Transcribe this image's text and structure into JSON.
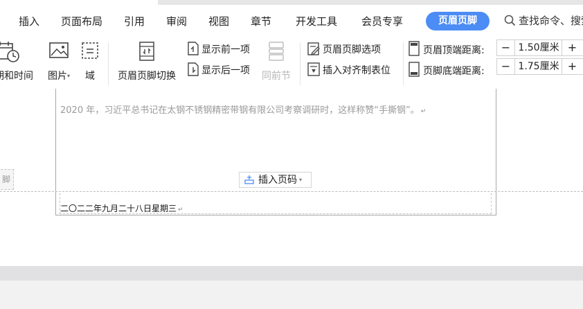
{
  "menubar": {
    "tabs": [
      {
        "label": "插入"
      },
      {
        "label": "页面布局"
      },
      {
        "label": "引用"
      },
      {
        "label": "审阅"
      },
      {
        "label": "视图"
      },
      {
        "label": "章节"
      },
      {
        "label": "开发工具"
      },
      {
        "label": "会员专享"
      }
    ],
    "active_tab": "页眉页脚",
    "search_text": "查找命令、搜索",
    "active_color": "#4b8cf5"
  },
  "ribbon": {
    "datetime_label": "期和时间",
    "picture_label": "图片",
    "field_label": "域",
    "switch_label": "页眉页脚切换",
    "show_prev": "显示前一项",
    "show_next": "显示后一项",
    "same_as_prev": "同前节",
    "hf_options": "页眉页脚选项",
    "insert_align_tab": "插入对齐制表位",
    "header_top_label": "页眉顶端距离:",
    "header_top_value": "1.50厘米",
    "footer_bottom_label": "页脚底端距离:",
    "footer_bottom_value": "1.75厘米",
    "minus": "−",
    "plus": "+"
  },
  "document": {
    "body_text": "2020 年，习近平总书记在太钢不锈钢精密带钢有限公司考察调研时，这样称赞“手撕钢”。",
    "paragraph_mark": "↵",
    "insert_page_number": "插入页码",
    "footer_text": "二〇二二年九月二十八日星期三",
    "left_label": "脚"
  }
}
